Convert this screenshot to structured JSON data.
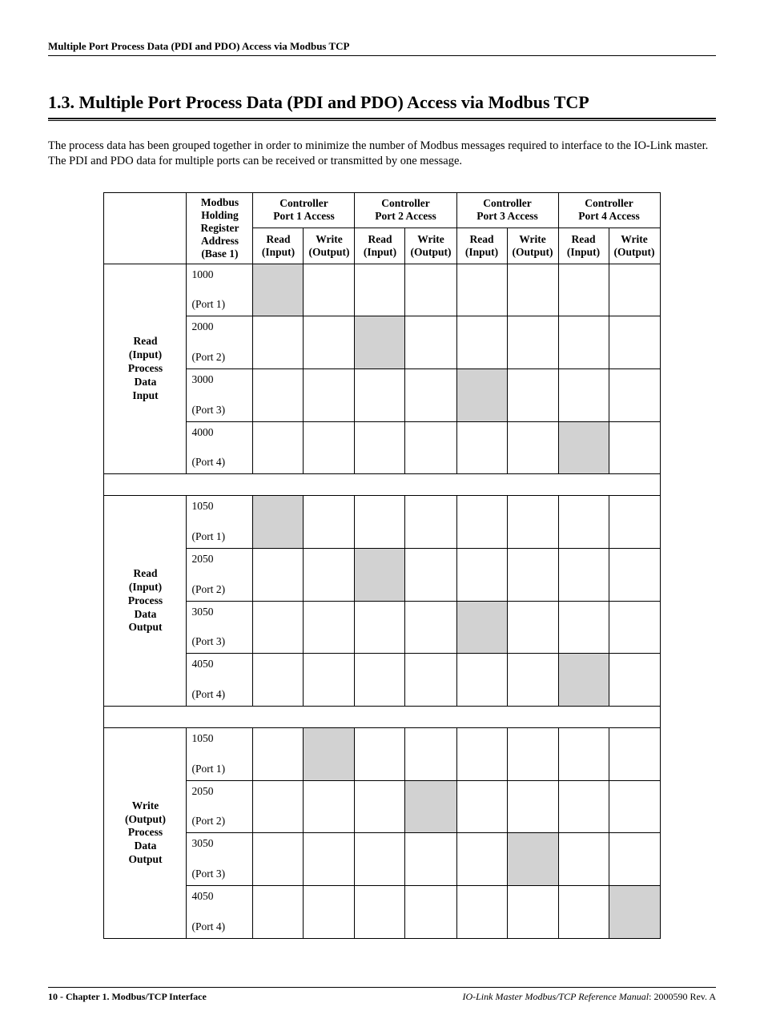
{
  "header": {
    "running": "Multiple Port Process Data (PDI and PDO) Access via Modbus TCP"
  },
  "section": {
    "number": "1.3.",
    "title": "Multiple Port Process Data (PDI and PDO) Access via Modbus TCP"
  },
  "intro": "The process data has been grouped together in order to minimize the number of Modbus messages required to interface to the IO-Link master. The PDI and PDO data for multiple ports can be received or transmitted by one message.",
  "table": {
    "col_modbus": {
      "l1": "Modbus",
      "l2": "Holding",
      "l3": "Register",
      "l4": "Address",
      "l5": "(Base 1)"
    },
    "ports": [
      {
        "top": "Controller",
        "bot": "Port 1 Access"
      },
      {
        "top": "Controller",
        "bot": "Port 2 Access"
      },
      {
        "top": "Controller",
        "bot": "Port 3 Access"
      },
      {
        "top": "Controller",
        "bot": "Port 4 Access"
      }
    ],
    "sub": {
      "read": "Read",
      "read2": "(Input)",
      "write": "Write",
      "write2": "(Output)"
    },
    "groups": [
      {
        "label": "Read (Input) Process Data Input",
        "shade_col": "read",
        "rows": [
          {
            "addr": "1000",
            "port": "(Port 1)"
          },
          {
            "addr": "2000",
            "port": "(Port 2)"
          },
          {
            "addr": "3000",
            "port": "(Port 3)"
          },
          {
            "addr": "4000",
            "port": "(Port 4)"
          }
        ]
      },
      {
        "label": "Read (Input) Process Data Output",
        "shade_col": "read",
        "rows": [
          {
            "addr": "1050",
            "port": "(Port 1)"
          },
          {
            "addr": "2050",
            "port": "(Port 2)"
          },
          {
            "addr": "3050",
            "port": "(Port 3)"
          },
          {
            "addr": "4050",
            "port": "(Port 4)"
          }
        ]
      },
      {
        "label": "Write (Output) Process Data Output",
        "shade_col": "write",
        "rows": [
          {
            "addr": "1050",
            "port": "(Port 1)"
          },
          {
            "addr": "2050",
            "port": "(Port 2)"
          },
          {
            "addr": "3050",
            "port": "(Port 3)"
          },
          {
            "addr": "4050",
            "port": "(Port 4)"
          }
        ]
      }
    ]
  },
  "footer": {
    "left": "10 - Chapter 1. Modbus/TCP Interface",
    "right_italic": "IO-Link Master Modbus/TCP Reference Manual",
    "right_rev": ": 2000590 Rev. A"
  }
}
